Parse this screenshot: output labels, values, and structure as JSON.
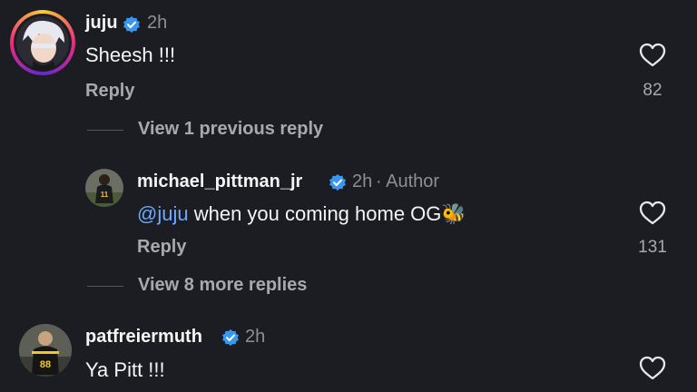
{
  "comments": [
    {
      "username": "juju",
      "time": "2h",
      "text": "Sheesh !!!",
      "reply_label": "Reply",
      "likes": "82"
    },
    {
      "username": "michael_pittman_jr",
      "time": "2h",
      "author_tag": "· Author",
      "mention": "@juju",
      "text": " when you coming home OG",
      "emoji": "🐝",
      "reply_label": "Reply",
      "likes": "131"
    },
    {
      "username": "patfreiermuth",
      "time": "2h",
      "text": "Ya Pitt !!!"
    }
  ],
  "view_previous": "View 1 previous reply",
  "view_more": "View 8 more replies",
  "colors": {
    "background": "#1c1d22",
    "verified": "#3897f0",
    "mention": "#6ea8ff",
    "muted": "#8e8e93"
  },
  "icons": [
    "heart-icon",
    "verified-badge-icon"
  ]
}
